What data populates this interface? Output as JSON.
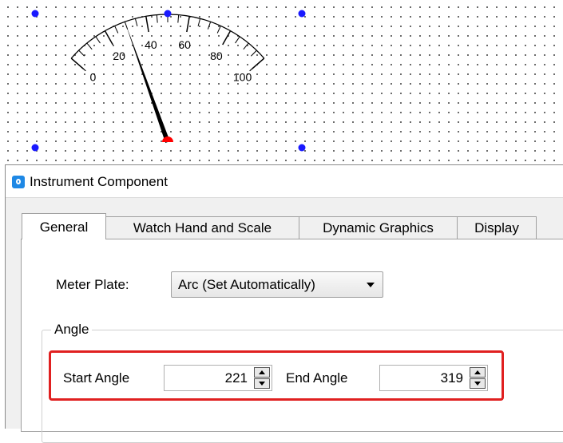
{
  "gauge": {
    "scale_labels": [
      "0",
      "20",
      "40",
      "60",
      "80",
      "100"
    ],
    "min": 0,
    "max": 100,
    "needle_value": 30,
    "needle_color": "#000000",
    "pivot_color": "#ff0000",
    "handle_color": "#1a1aff"
  },
  "dialog": {
    "title": "Instrument Component",
    "tabs": [
      "General",
      "Watch Hand and Scale",
      "Dynamic Graphics",
      "Display"
    ],
    "active_tab": "General",
    "meter_plate_label": "Meter Plate:",
    "meter_plate_value": "Arc (Set Automatically)",
    "angle_group_title": "Angle",
    "start_angle_label": "Start Angle",
    "start_angle_value": "221",
    "end_angle_label": "End Angle",
    "end_angle_value": "319",
    "highlight_color": "#e02020"
  }
}
